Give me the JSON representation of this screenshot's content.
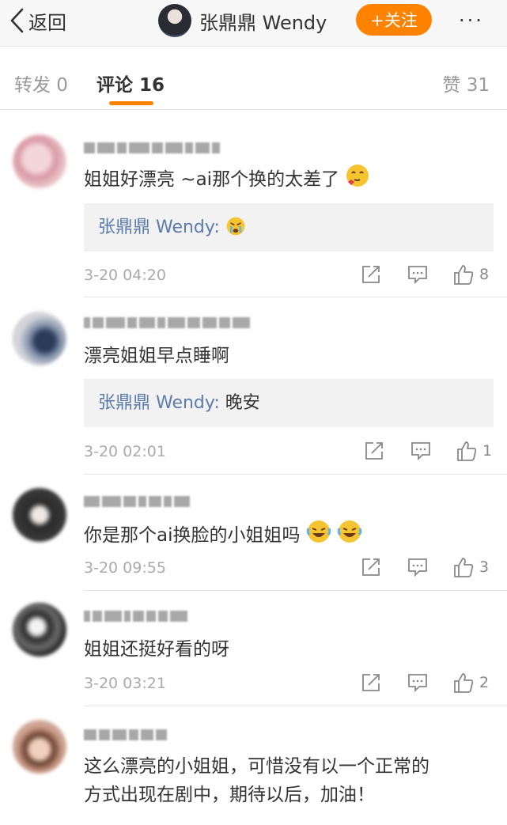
{
  "header": {
    "back_label": "返回",
    "title": "张鼎鼎 Wendy",
    "follow_label": "+关注",
    "more_label": "···"
  },
  "tabs": {
    "forward": "转发 0",
    "comments": "评论 16",
    "likes": "赞 31"
  },
  "accent_color": "#ff8200",
  "comments": [
    {
      "text": "姐姐好漂亮 ~ai那个换的太差了",
      "emoji": "face-hearts",
      "reply": {
        "author": "张鼎鼎 Wendy:",
        "text": "",
        "emoji": "crying-face"
      },
      "time": "3-20 04:20",
      "likes": "8"
    },
    {
      "text": "漂亮姐姐早点睡啊",
      "reply": {
        "author": "张鼎鼎 Wendy:",
        "text": "晚安"
      },
      "time": "3-20 02:01",
      "likes": "1"
    },
    {
      "text": "你是那个ai换脸的小姐姐吗",
      "emoji": "laughing-face x2",
      "time": "3-20 09:55",
      "likes": "3"
    },
    {
      "text": "姐姐还挺好看的呀",
      "time": "3-20 03:21",
      "likes": "2"
    },
    {
      "text_line1": "这么漂亮的小姐姐，可惜没有以一个正常的",
      "text_line2": "方式出现在剧中，期待以后，加油！"
    }
  ]
}
